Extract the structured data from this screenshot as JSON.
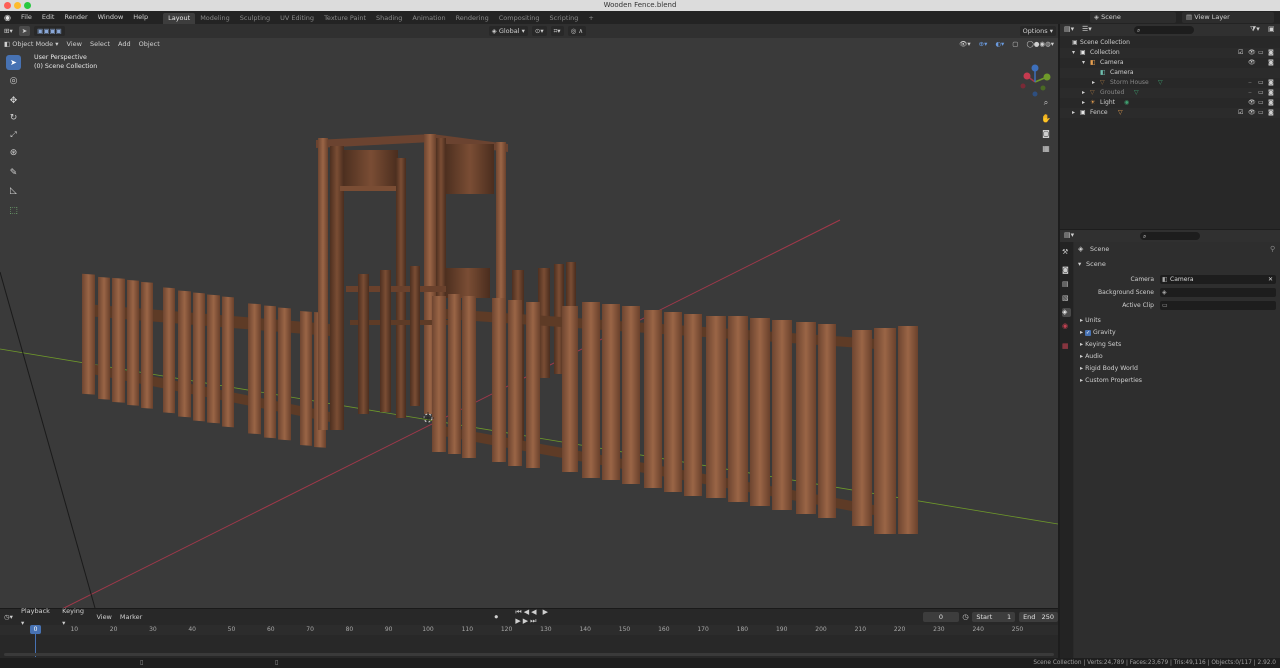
{
  "window": {
    "title": "Wooden Fence.blend"
  },
  "menu": [
    "File",
    "Edit",
    "Render",
    "Window",
    "Help"
  ],
  "workspaces": [
    "Layout",
    "Modeling",
    "Sculpting",
    "UV Editing",
    "Texture Paint",
    "Shading",
    "Animation",
    "Rendering",
    "Compositing",
    "Scripting",
    "+"
  ],
  "active_workspace": "Layout",
  "scene_selector": "Scene",
  "view_layer_selector": "View Layer",
  "viewport": {
    "mode": "Object Mode",
    "menus": [
      "View",
      "Select",
      "Add",
      "Object"
    ],
    "orientation": "Global",
    "options_label": "Options",
    "view_name": "User Perspective",
    "collection_info": "(0) Scene Collection"
  },
  "outliner": {
    "root": "Scene Collection",
    "items": [
      {
        "label": "Collection",
        "indent": 1,
        "icon": "collection-icon"
      },
      {
        "label": "Camera",
        "indent": 2,
        "icon": "camera-object-icon"
      },
      {
        "label": "Camera",
        "indent": 3,
        "icon": "camera-data-icon"
      },
      {
        "label": "Storm House",
        "indent": 3,
        "icon": "mesh-icon",
        "dim": true
      },
      {
        "label": "Grouted",
        "indent": 2,
        "icon": "mesh-icon",
        "dim": true
      },
      {
        "label": "Light",
        "indent": 2,
        "icon": "light-icon"
      },
      {
        "label": "Fence",
        "indent": 1,
        "icon": "mesh-icon"
      }
    ]
  },
  "properties": {
    "breadcrumb": "Scene",
    "panel_title": "Scene",
    "fields": [
      {
        "label": "Camera",
        "value": "Camera"
      },
      {
        "label": "Background Scene",
        "value": ""
      },
      {
        "label": "Active Clip",
        "value": ""
      }
    ],
    "panels": [
      "Units",
      "Gravity",
      "Keying Sets",
      "Audio",
      "Rigid Body World",
      "Custom Properties"
    ],
    "gravity_checked": true
  },
  "timeline": {
    "menus": [
      "Playback",
      "Keying",
      "View",
      "Marker"
    ],
    "current_frame": "0",
    "start_label": "Start",
    "start": "1",
    "end_label": "End",
    "end": "250",
    "ruler": [
      "0",
      "10",
      "20",
      "30",
      "40",
      "50",
      "60",
      "70",
      "80",
      "90",
      "100",
      "110",
      "120",
      "130",
      "140",
      "150",
      "160",
      "170",
      "180",
      "190",
      "200",
      "210",
      "220",
      "230",
      "240",
      "250"
    ]
  },
  "status": "Scene Collection | Verts:24,789 | Faces:23,679 | Tris:49,116 | Objects:0/117 | 2.92.0",
  "colors": {
    "accent": "#4772b3",
    "wood": "#8a5a3c",
    "wood_dark": "#5e3b26",
    "axis_x": "#a3384a",
    "axis_y": "#6f9a2a"
  }
}
